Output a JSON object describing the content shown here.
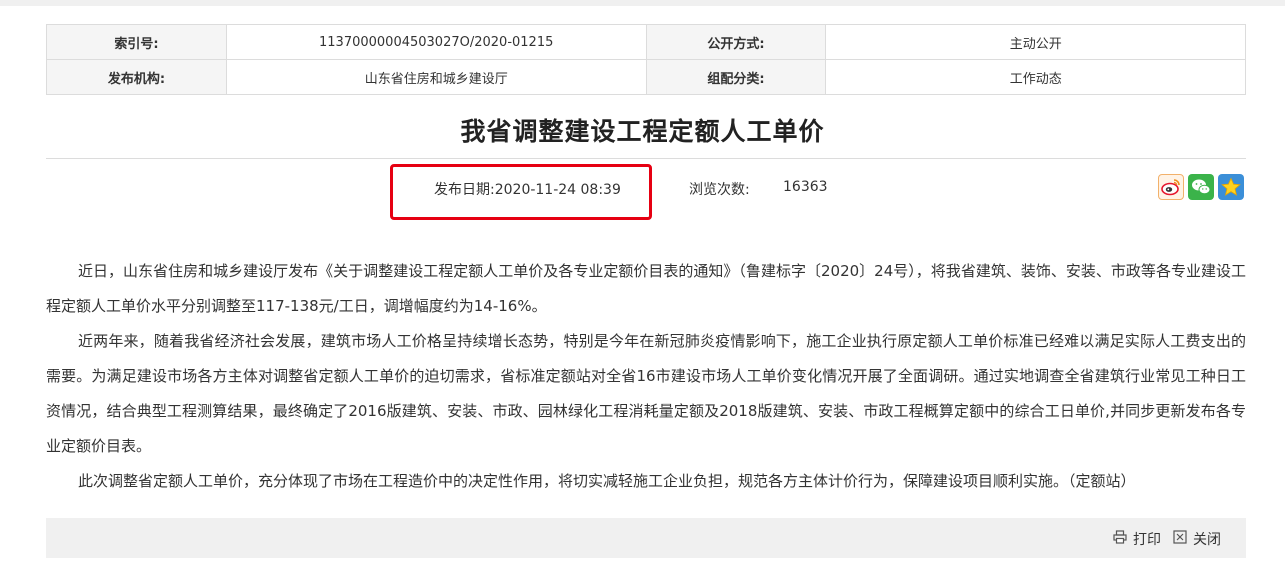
{
  "meta": {
    "index_label": "索引号:",
    "index_value": "11370000004503027O/2020-01215",
    "open_label": "公开方式:",
    "open_value": "主动公开",
    "publisher_label": "发布机构:",
    "publisher_value": "山东省住房和城乡建设厅",
    "category_label": "组配分类:",
    "category_value": "工作动态"
  },
  "article": {
    "title": "我省调整建设工程定额人工单价",
    "date_label": "发布日期:2020-11-24 08:39",
    "views_label": "浏览次数:",
    "views_count": "16363",
    "paragraphs": [
      "近日，山东省住房和城乡建设厅发布《关于调整建设工程定额人工单价及各专业定额价目表的通知》（鲁建标字〔2020〕24号），将我省建筑、装饰、安装、市政等各专业建设工程定额人工单价水平分别调整至117-138元/工日，调增幅度约为14-16%。",
      "近两年来，随着我省经济社会发展，建筑市场人工价格呈持续增长态势，特别是今年在新冠肺炎疫情影响下，施工企业执行原定额人工单价标准已经难以满足实际人工费支出的需要。为满足建设市场各方主体对调整省定额人工单价的迫切需求，省标准定额站对全省16市建设市场人工单价变化情况开展了全面调研。通过实地调查全省建筑行业常见工种日工资情况，结合典型工程测算结果，最终确定了2016版建筑、安装、市政、园林绿化工程消耗量定额及2018版建筑、安装、市政工程概算定额中的综合工日单价,并同步更新发布各专业定额价目表。",
      "此次调整省定额人工单价，充分体现了市场在工程造价中的决定性作用，将切实减轻施工企业负担，规范各方主体计价行为，保障建设项目顺利实施。（定额站）"
    ]
  },
  "share_icons": [
    "weibo-icon",
    "wechat-icon",
    "favorite-star-icon"
  ],
  "actions": {
    "print_label": "打印",
    "close_label": "关闭"
  },
  "colors": {
    "highlight_box": "#e60012",
    "table_border": "#dcdcdc",
    "header_cell_bg": "#f5f5f5",
    "bottom_bar_bg": "#f0f0f0"
  }
}
